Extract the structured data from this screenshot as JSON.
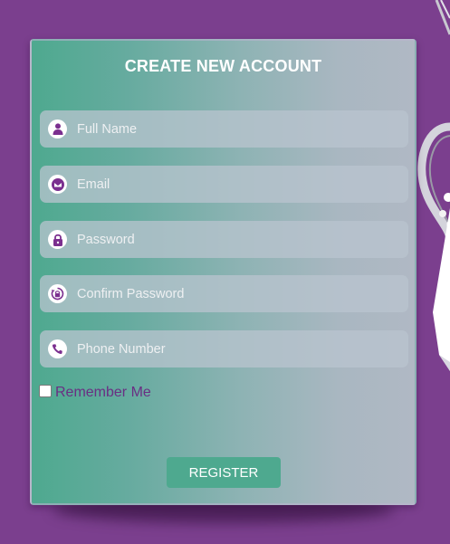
{
  "form": {
    "title": "CREATE NEW ACCOUNT",
    "fields": [
      {
        "name": "full-name",
        "icon": "user-icon",
        "placeholder": "Full Name",
        "value": ""
      },
      {
        "name": "email",
        "icon": "envelope-icon",
        "placeholder": "Email",
        "value": ""
      },
      {
        "name": "password",
        "icon": "lock-icon",
        "placeholder": "Password",
        "value": ""
      },
      {
        "name": "confirm-password",
        "icon": "lock-reset-icon",
        "placeholder": "Confirm Password",
        "value": ""
      },
      {
        "name": "phone",
        "icon": "phone-icon",
        "placeholder": "Phone Number",
        "value": ""
      }
    ],
    "remember_label": "Remember Me",
    "remember_checked": false,
    "register_label": "REGISTER"
  },
  "colors": {
    "background": "#7b3f8e",
    "accent": "#4ea98f",
    "icon_color": "#7b2f8f",
    "label_color": "#6a2f83"
  }
}
